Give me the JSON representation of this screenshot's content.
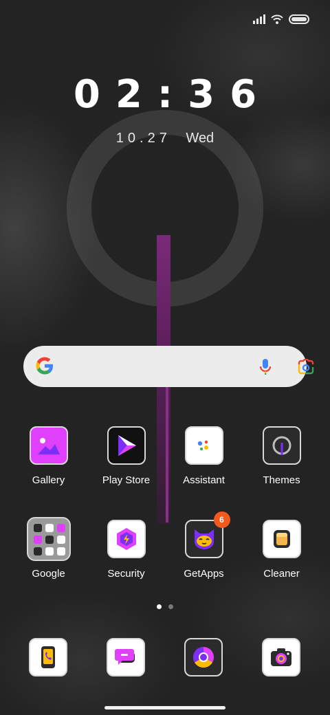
{
  "status_bar": {
    "signal_icon": "signal-bars-icon",
    "wifi_icon": "wifi-icon",
    "battery_icon": "battery-full-icon"
  },
  "lockscreen": {
    "time": "02:36",
    "date": "10.27",
    "weekday": "Wed"
  },
  "search_bar": {
    "logo_icon": "google-g-icon",
    "mic_icon": "microphone-icon",
    "lens_icon": "google-lens-icon"
  },
  "apps_row1": [
    {
      "label": "Gallery",
      "icon": "gallery-icon"
    },
    {
      "label": "Play Store",
      "icon": "play-store-icon"
    },
    {
      "label": "Assistant",
      "icon": "assistant-icon"
    },
    {
      "label": "Themes",
      "icon": "themes-icon"
    }
  ],
  "apps_row2": [
    {
      "label": "Google",
      "icon": "google-folder-icon"
    },
    {
      "label": "Security",
      "icon": "security-icon"
    },
    {
      "label": "GetApps",
      "icon": "getapps-icon",
      "badge": "6"
    },
    {
      "label": "Cleaner",
      "icon": "cleaner-icon"
    }
  ],
  "dock": [
    {
      "icon": "phone-icon"
    },
    {
      "icon": "messages-icon"
    },
    {
      "icon": "chrome-icon"
    },
    {
      "icon": "camera-icon"
    }
  ],
  "page_indicator": {
    "pages": 2,
    "current": 1
  },
  "colors": {
    "accent_magenta": "#e040fb",
    "purple": "#7b2ff7",
    "badge": "#f25a1d",
    "background": "#232323"
  }
}
